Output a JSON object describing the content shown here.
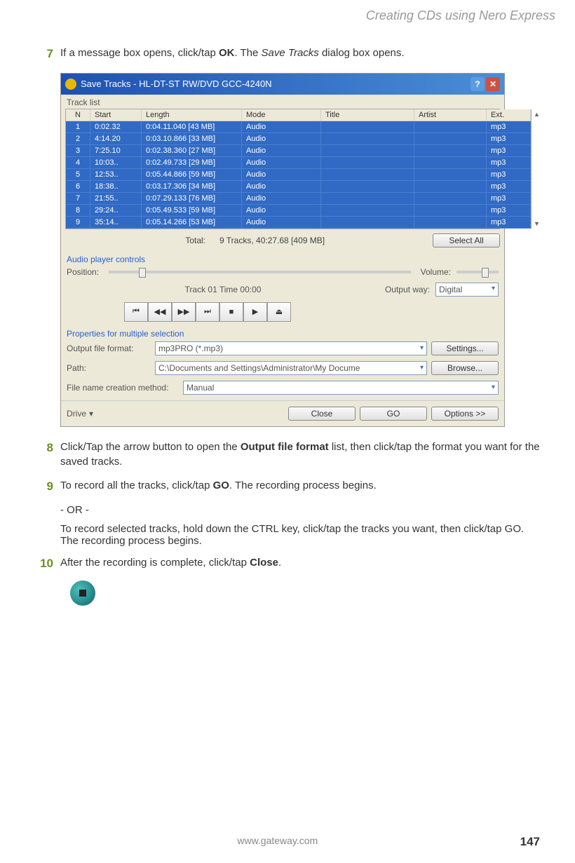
{
  "header": {
    "title": "Creating CDs using Nero Express"
  },
  "steps": {
    "s7": {
      "num": "7",
      "t1": "If a message box opens, click/tap ",
      "b1": "OK",
      "t2": ". The ",
      "i1": "Save Tracks",
      "t3": " dialog box opens."
    },
    "s8": {
      "num": "8",
      "t1a": "Click/Tap the arrow button to open the ",
      "b1": "Output file format",
      "t1b": " list, then click/tap the format you want for the saved tracks."
    },
    "s9": {
      "num": "9",
      "p1a": "To record all the tracks, click/tap ",
      "p1b": "GO",
      "p1c": ". The recording process begins.",
      "or": "- OR -",
      "p2a": "To record selected tracks, hold down the ",
      "p2b": "CTRL",
      "p2c": " key, click/tap the tracks you want, then click/tap ",
      "p2d": "GO",
      "p2e": ". The recording process begins."
    },
    "s10": {
      "num": "10",
      "t1": "After the recording is complete, click/tap ",
      "b1": "Close",
      "t2": "."
    }
  },
  "dialog": {
    "title": "Save Tracks - HL-DT-ST RW/DVD GCC-4240N",
    "tracklist_label": "Track list",
    "headers": {
      "n": "N",
      "start": "Start",
      "length": "Length",
      "mode": "Mode",
      "title": "Title",
      "artist": "Artist",
      "ext": "Ext."
    },
    "rows": [
      {
        "n": "1",
        "start": "0:02.32",
        "len": "0:04.11.040 [43 MB]",
        "mode": "Audio",
        "ext": "mp3"
      },
      {
        "n": "2",
        "start": "4:14.20",
        "len": "0:03.10.866 [33 MB]",
        "mode": "Audio",
        "ext": "mp3"
      },
      {
        "n": "3",
        "start": "7:25.10",
        "len": "0:02.38.360 [27 MB]",
        "mode": "Audio",
        "ext": "mp3"
      },
      {
        "n": "4",
        "start": "10:03..",
        "len": "0:02.49.733 [29 MB]",
        "mode": "Audio",
        "ext": "mp3"
      },
      {
        "n": "5",
        "start": "12:53..",
        "len": "0:05.44.866 [59 MB]",
        "mode": "Audio",
        "ext": "mp3"
      },
      {
        "n": "6",
        "start": "18:38..",
        "len": "0:03.17.306 [34 MB]",
        "mode": "Audio",
        "ext": "mp3"
      },
      {
        "n": "7",
        "start": "21:55..",
        "len": "0:07.29.133 [76 MB]",
        "mode": "Audio",
        "ext": "mp3"
      },
      {
        "n": "8",
        "start": "29:24..",
        "len": "0:05.49.533 [59 MB]",
        "mode": "Audio",
        "ext": "mp3"
      },
      {
        "n": "9",
        "start": "35:14..",
        "len": "0:05.14.266 [53 MB]",
        "mode": "Audio",
        "ext": "mp3"
      }
    ],
    "total_label": "Total:",
    "total_value": "9 Tracks,   40:27.68 [409 MB]",
    "select_all": "Select All",
    "audio_controls": "Audio player controls",
    "position": "Position:",
    "volume": "Volume:",
    "track_time": "Track 01 Time 00:00",
    "output_way": "Output way:",
    "output_way_val": "Digital",
    "props_label": "Properties for multiple selection",
    "out_fmt_label": "Output file format:",
    "out_fmt_val": "mp3PRO (*.mp3)",
    "settings": "Settings...",
    "path_label": "Path:",
    "path_val": "C:\\Documents and Settings\\Administrator\\My Docume",
    "browse": "Browse...",
    "fname_label": "File name creation method:",
    "fname_val": "Manual",
    "drive": "Drive",
    "close": "Close",
    "go": "GO",
    "options": "Options >>"
  },
  "footer": {
    "url": "www.gateway.com",
    "page": "147"
  }
}
